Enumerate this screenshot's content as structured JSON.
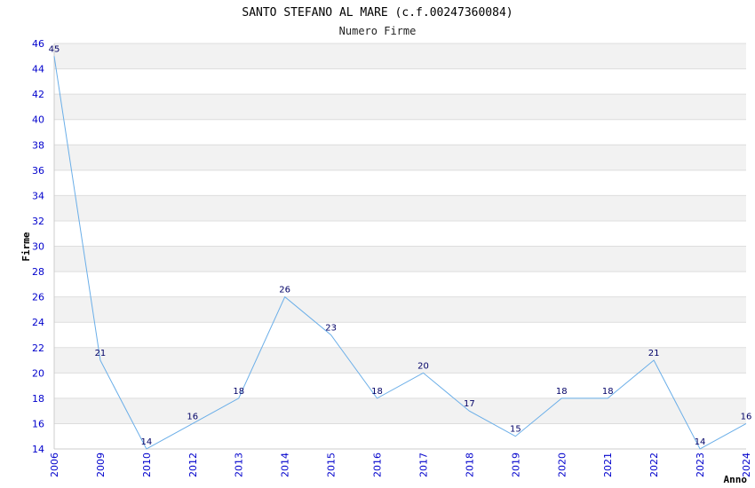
{
  "chart_data": {
    "type": "line",
    "title": "SANTO STEFANO AL MARE (c.f.00247360084)",
    "subtitle": "Numero Firme",
    "ylabel": "Firme",
    "xlabel": "Anno",
    "x": [
      "2006",
      "2009",
      "2010",
      "2012",
      "2013",
      "2014",
      "2015",
      "2016",
      "2017",
      "2018",
      "2019",
      "2020",
      "2021",
      "2022",
      "2023",
      "2024"
    ],
    "values": [
      45,
      21,
      14,
      16,
      18,
      26,
      23,
      18,
      20,
      17,
      15,
      18,
      18,
      21,
      14,
      16
    ],
    "ylim": [
      14,
      46
    ],
    "yticks": [
      14,
      16,
      18,
      20,
      22,
      24,
      26,
      28,
      30,
      32,
      34,
      36,
      38,
      40,
      42,
      44,
      46
    ],
    "grid": true,
    "line_color": "#6aaee8",
    "band_color": "#f2f2f2",
    "tick_color": "#0000cc"
  }
}
